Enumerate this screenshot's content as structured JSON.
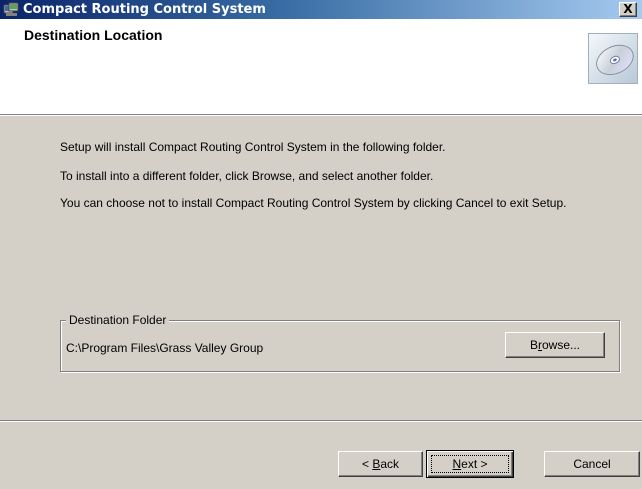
{
  "window": {
    "title": "Compact Routing Control System",
    "close_label": "X"
  },
  "header": {
    "title": "Destination Location"
  },
  "content": {
    "line1": "Setup will install Compact Routing Control System in the following folder.",
    "line2": "To install into a different folder, click Browse, and select another folder.",
    "line3": "You can choose not to install Compact Routing Control System by clicking Cancel to exit Setup."
  },
  "destination": {
    "group_label": "Destination Folder",
    "path": "C:\\Program Files\\Grass Valley Group",
    "browse_prefix": "B",
    "browse_mnemonic": "r",
    "browse_suffix": "owse..."
  },
  "footer": {
    "back_prefix": "< ",
    "back_mnemonic": "B",
    "back_suffix": "ack",
    "next_mnemonic": "N",
    "next_suffix": "ext >",
    "cancel_label": "Cancel"
  },
  "colors": {
    "titlebar_start": "#0a246a",
    "titlebar_end": "#a6caf0",
    "dialog_face": "#d4d0c8",
    "header_bg": "#ffffff"
  }
}
